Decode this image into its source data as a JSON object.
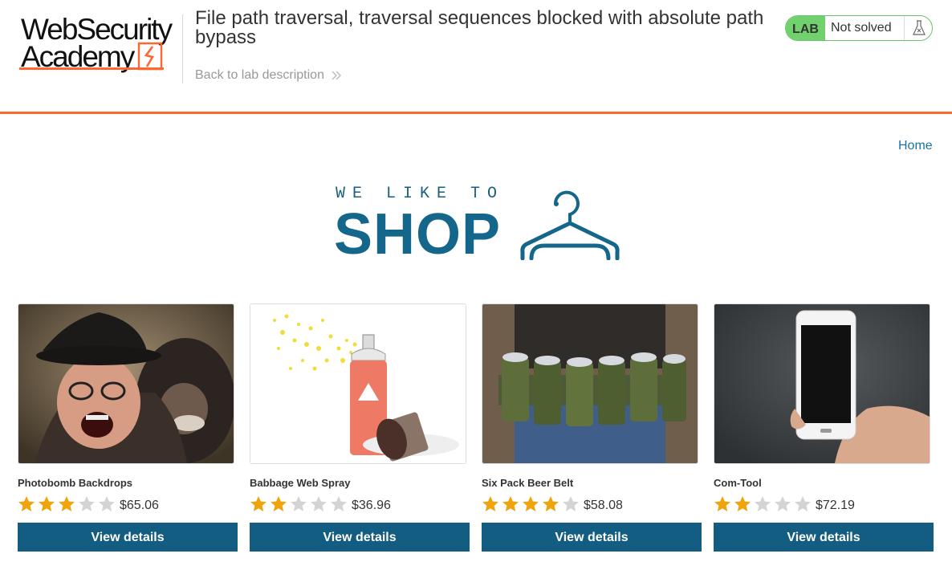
{
  "header": {
    "logo_line1": "WebSecurity",
    "logo_line2": "Academy",
    "lab_title": "File path traversal, traversal sequences blocked with absolute path bypass",
    "back_link": "Back to lab description",
    "lab_badge": {
      "label": "LAB",
      "status": "Not solved",
      "icon": "flask-icon"
    }
  },
  "nav": {
    "home": "Home"
  },
  "banner": {
    "tagline": "WE LIKE TO",
    "word": "SHOP",
    "icon": "hanger-icon"
  },
  "colors": {
    "accent_orange": "#ff6633",
    "brand_blue": "#135d82",
    "link_blue": "#1a72a8",
    "lab_green": "#70d16d",
    "star_gold": "#f0a30a",
    "star_grey": "#d4d4d4"
  },
  "products": [
    {
      "name": "Photobomb Backdrops",
      "rating": 3,
      "price": "$65.06",
      "button": "View details"
    },
    {
      "name": "Babbage Web Spray",
      "rating": 2,
      "price": "$36.96",
      "button": "View details"
    },
    {
      "name": "Six Pack Beer Belt",
      "rating": 4,
      "price": "$58.08",
      "button": "View details"
    },
    {
      "name": "Com-Tool",
      "rating": 2,
      "price": "$72.19",
      "button": "View details"
    }
  ]
}
